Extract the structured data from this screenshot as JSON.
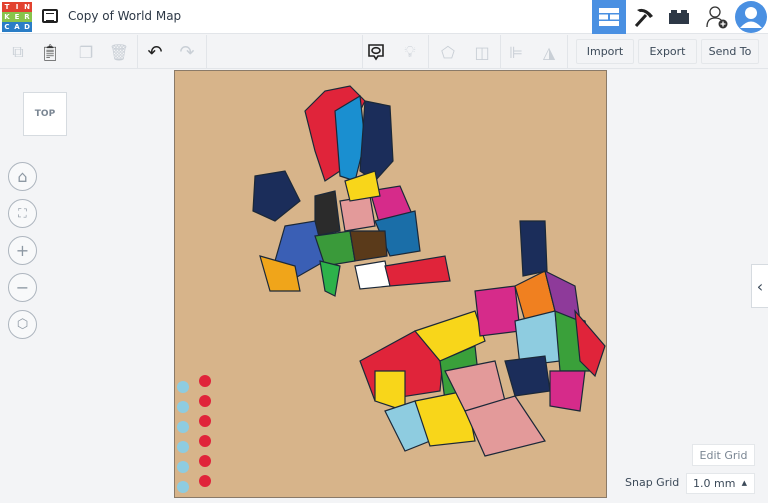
{
  "app": {
    "logo_letters": [
      "T",
      "I",
      "N",
      "K",
      "E",
      "R",
      "C",
      "A",
      "D"
    ],
    "logo_colors": [
      "#e2422f",
      "#e2422f",
      "#e2422f",
      "#88c34b",
      "#88c34b",
      "#88c34b",
      "#2a7dc6",
      "#2a7dc6",
      "#2a7dc6"
    ],
    "title": "Copy of World Map"
  },
  "topnav": {
    "icons": [
      "grid-view-icon",
      "pickaxe-icon",
      "bricks-icon",
      "add-user-icon",
      "avatar"
    ],
    "active_color": "#4a90e2"
  },
  "toolbar": {
    "import_label": "Import",
    "export_label": "Export",
    "send_to_label": "Send To"
  },
  "view": {
    "cube_label": "TOP"
  },
  "grid": {
    "edit_label": "Edit Grid",
    "snap_label": "Snap Grid",
    "snap_value": "1.0 mm"
  }
}
